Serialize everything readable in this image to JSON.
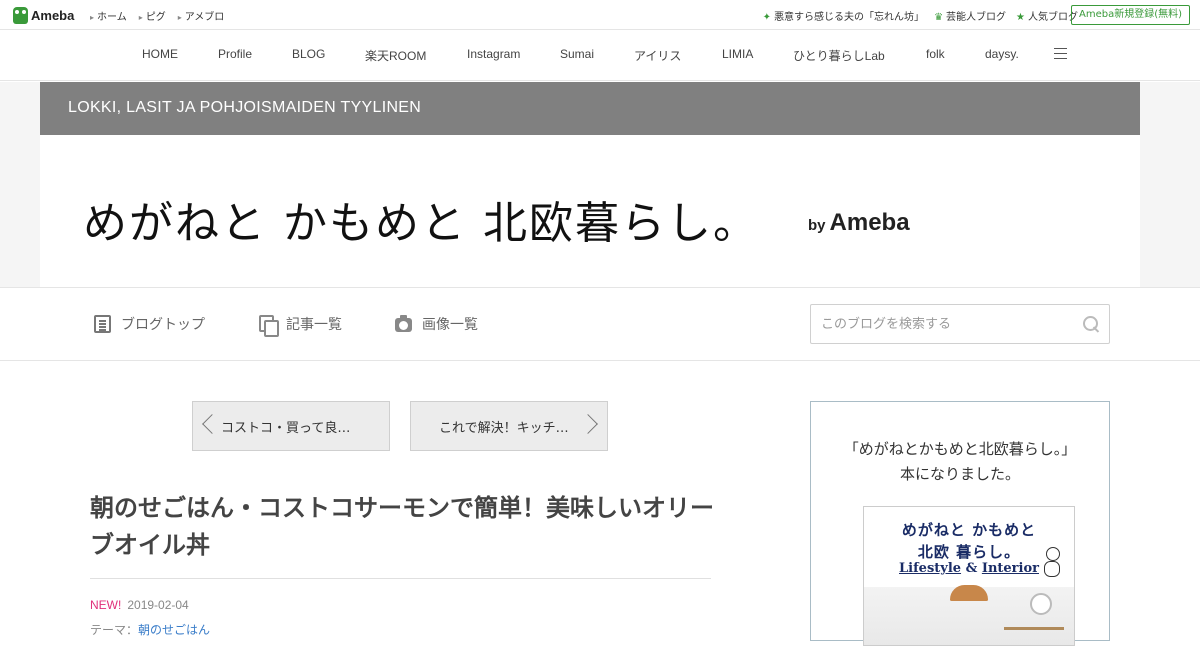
{
  "topbar": {
    "logo_text": "Ameba",
    "links": [
      "ホーム",
      "ピグ",
      "アメブロ"
    ],
    "right_links": [
      {
        "icon": "sparkle-icon",
        "label": "悪意すら感じる夫の「忘れん坊」"
      },
      {
        "icon": "crown-icon",
        "label": "芸能人ブログ"
      },
      {
        "icon": "star-icon",
        "label": "人気ブログ"
      }
    ],
    "register_label": "Ameba新規登録(無料)"
  },
  "mainnav": {
    "items": [
      "HOME",
      "Profile",
      "BLOG",
      "楽天ROOM",
      "Instagram",
      "Sumai",
      "アイリス",
      "LIMIA",
      "ひとり暮らしLab",
      "folk",
      "daysy."
    ]
  },
  "header": {
    "subtitle": "LOKKI, LASIT JA POHJOISMAIDEN TYYLINEN",
    "title": "めがねと かもめと 北欧暮らし。",
    "by": "by",
    "brand": "Ameba"
  },
  "subnav": {
    "blog_top": "ブログトップ",
    "article_list": "記事一覧",
    "image_list": "画像一覧",
    "search_placeholder": "このブログを検索する"
  },
  "pager": {
    "prev_label": "コストコ・買って良…",
    "next_label": "これで解決！キッチ…"
  },
  "article": {
    "title": "朝のせごはん・コストコサーモンで簡単！美味しいオリーブオイル丼",
    "new_badge": "NEW!",
    "date": "2019-02-04",
    "theme_label": "テーマ：",
    "theme_value": "朝のせごはん"
  },
  "sidebar": {
    "line1": "「めがねとかもめと北欧暮らし。」",
    "line2": "本になりました。",
    "book": {
      "title_line1": "めがねと かもめと",
      "title_line2": "北欧 暮らし。",
      "subtitle_a": "Lifestyle",
      "subtitle_amp": "&",
      "subtitle_b": "Interior"
    }
  }
}
